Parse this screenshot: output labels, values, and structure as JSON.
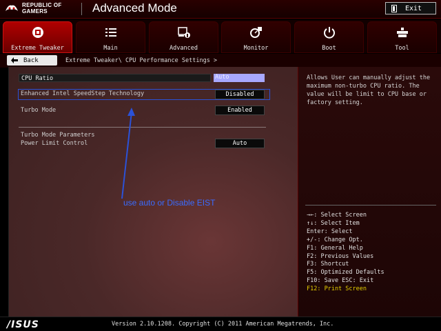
{
  "header": {
    "brand_line1": "REPUBLIC OF",
    "brand_line2": "GAMERS",
    "mode_title": "Advanced Mode",
    "exit_label": "Exit"
  },
  "tabs": [
    {
      "label": "Extreme Tweaker",
      "icon": "extreme-tweaker-icon",
      "active": true
    },
    {
      "label": "Main",
      "icon": "list-icon",
      "active": false
    },
    {
      "label": "Advanced",
      "icon": "advanced-settings-icon",
      "active": false
    },
    {
      "label": "Monitor",
      "icon": "monitor-gauge-icon",
      "active": false
    },
    {
      "label": "Boot",
      "icon": "power-icon",
      "active": false
    },
    {
      "label": "Tool",
      "icon": "tool-icon",
      "active": false
    }
  ],
  "nav": {
    "back_label": "Back",
    "breadcrumb": "Extreme Tweaker\\ CPU Performance Settings >"
  },
  "settings": {
    "cpu_ratio": {
      "label": "CPU Ratio",
      "value": "Auto"
    },
    "eist": {
      "label": "Enhanced Intel SpeedStep Technology",
      "value": "Disabled"
    },
    "turbo": {
      "label": "Turbo Mode",
      "value": "Enabled"
    },
    "turbo_params_header": "Turbo Mode Parameters",
    "power_limit": {
      "label": "Power Limit Control",
      "value": "Auto"
    }
  },
  "annotation": {
    "text": "use auto or Disable EIST",
    "color": "#3a6cff"
  },
  "help": {
    "description": "Allows User can manually adjust the maximum non-turbo CPU ratio. The value will be limit to CPU base or factory setting.",
    "keys": [
      "→←: Select Screen",
      "↑↓: Select Item",
      "Enter: Select",
      "+/-: Change Opt.",
      "F1: General Help",
      "F2: Previous Values",
      "F3: Shortcut",
      "F5: Optimized Defaults",
      "F10: Save  ESC: Exit",
      "F12: Print Screen"
    ]
  },
  "footer": {
    "logo": "/ISUS",
    "version": "Version 2.10.1208. Copyright (C) 2011 American Megatrends, Inc."
  },
  "colors": {
    "accent_red": "#b00000",
    "highlight_blue": "#2b52d8",
    "key_yellow": "#e6d000"
  }
}
